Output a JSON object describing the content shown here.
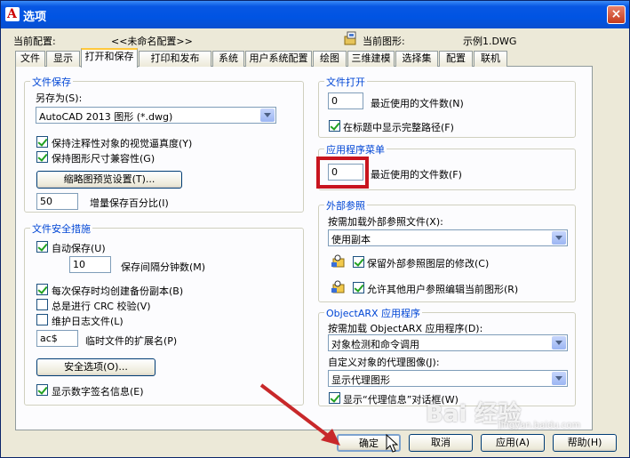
{
  "window": {
    "title": "选项",
    "close_label": "×",
    "app_icon_glyph": "A"
  },
  "header": {
    "current_profile_label": "当前配置:",
    "current_profile_value": "<<未命名配置>>",
    "current_drawing_label": "当前图形:",
    "current_drawing_value": "示例1.DWG"
  },
  "tabs": [
    {
      "label": "文件",
      "active": false
    },
    {
      "label": "显示",
      "active": false
    },
    {
      "label": "打开和保存",
      "active": true
    },
    {
      "label": "打印和发布",
      "active": false
    },
    {
      "label": "系统",
      "active": false
    },
    {
      "label": "用户系统配置",
      "active": false
    },
    {
      "label": "绘图",
      "active": false
    },
    {
      "label": "三维建模",
      "active": false
    },
    {
      "label": "选择集",
      "active": false
    },
    {
      "label": "配置",
      "active": false
    },
    {
      "label": "联机",
      "active": false
    }
  ],
  "file_save": {
    "title": "文件保存",
    "save_as_label": "另存为(S):",
    "save_as_value": "AutoCAD 2013 图形 (*.dwg)",
    "maintain_visual_fidelity": {
      "label": "保持注释性对象的视觉逼真度(Y)",
      "checked": true
    },
    "maintain_drawing_size": {
      "label": "保持图形尺寸兼容性(G)",
      "checked": true
    },
    "thumbnail_button": "缩略图预览设置(T)...",
    "incremental_value": "50",
    "incremental_label": "增量保存百分比(I)"
  },
  "file_safety": {
    "title": "文件安全措施",
    "autosave": {
      "label": "自动保存(U)",
      "checked": true
    },
    "interval_value": "10",
    "interval_label": "保存间隔分钟数(M)",
    "backup": {
      "label": "每次保存时均创建备份副本(B)",
      "checked": true
    },
    "crc": {
      "label": "总是进行 CRC 校验(V)",
      "checked": false
    },
    "log": {
      "label": "维护日志文件(L)",
      "checked": false
    },
    "temp_ext_value": "ac$",
    "temp_ext_label": "临时文件的扩展名(P)",
    "security_button": "安全选项(O)...",
    "digital_sig": {
      "label": "显示数字签名信息(E)",
      "checked": true
    }
  },
  "file_open": {
    "title": "文件打开",
    "recent_value": "0",
    "recent_label": "最近使用的文件数(N)",
    "full_path": {
      "label": "在标题中显示完整路径(F)",
      "checked": true
    }
  },
  "app_menu": {
    "title": "应用程序菜单",
    "recent_value": "0",
    "recent_label": "最近使用的文件数(F)"
  },
  "xref": {
    "title": "外部参照",
    "demand_load_label": "按需加载外部参照文件(X):",
    "demand_load_value": "使用副本",
    "retain_changes": {
      "label": "保留外部参照图层的修改(C)",
      "checked": true
    },
    "allow_edit": {
      "label": "允许其他用户参照编辑当前图形(R)",
      "checked": true
    }
  },
  "objectarx": {
    "title": "ObjectARX 应用程序",
    "demand_load_label": "按需加载 ObjectARX 应用程序(D):",
    "demand_load_value": "对象检测和命令调用",
    "proxy_images_label": "自定义对象的代理图像(J):",
    "proxy_images_value": "显示代理图形",
    "proxy_info": {
      "label": "显示“代理信息”对话框(W)",
      "checked": true
    }
  },
  "buttons": {
    "ok": "确定",
    "cancel": "取消",
    "apply": "应用(A)",
    "help": "帮助(H)"
  },
  "watermark": {
    "main": "Bai 经验",
    "sub": "jingyan.baidu.com"
  },
  "colors": {
    "accent_title": "#0054e3",
    "group_title": "#0046d5",
    "highlight_red": "#c8141e"
  }
}
